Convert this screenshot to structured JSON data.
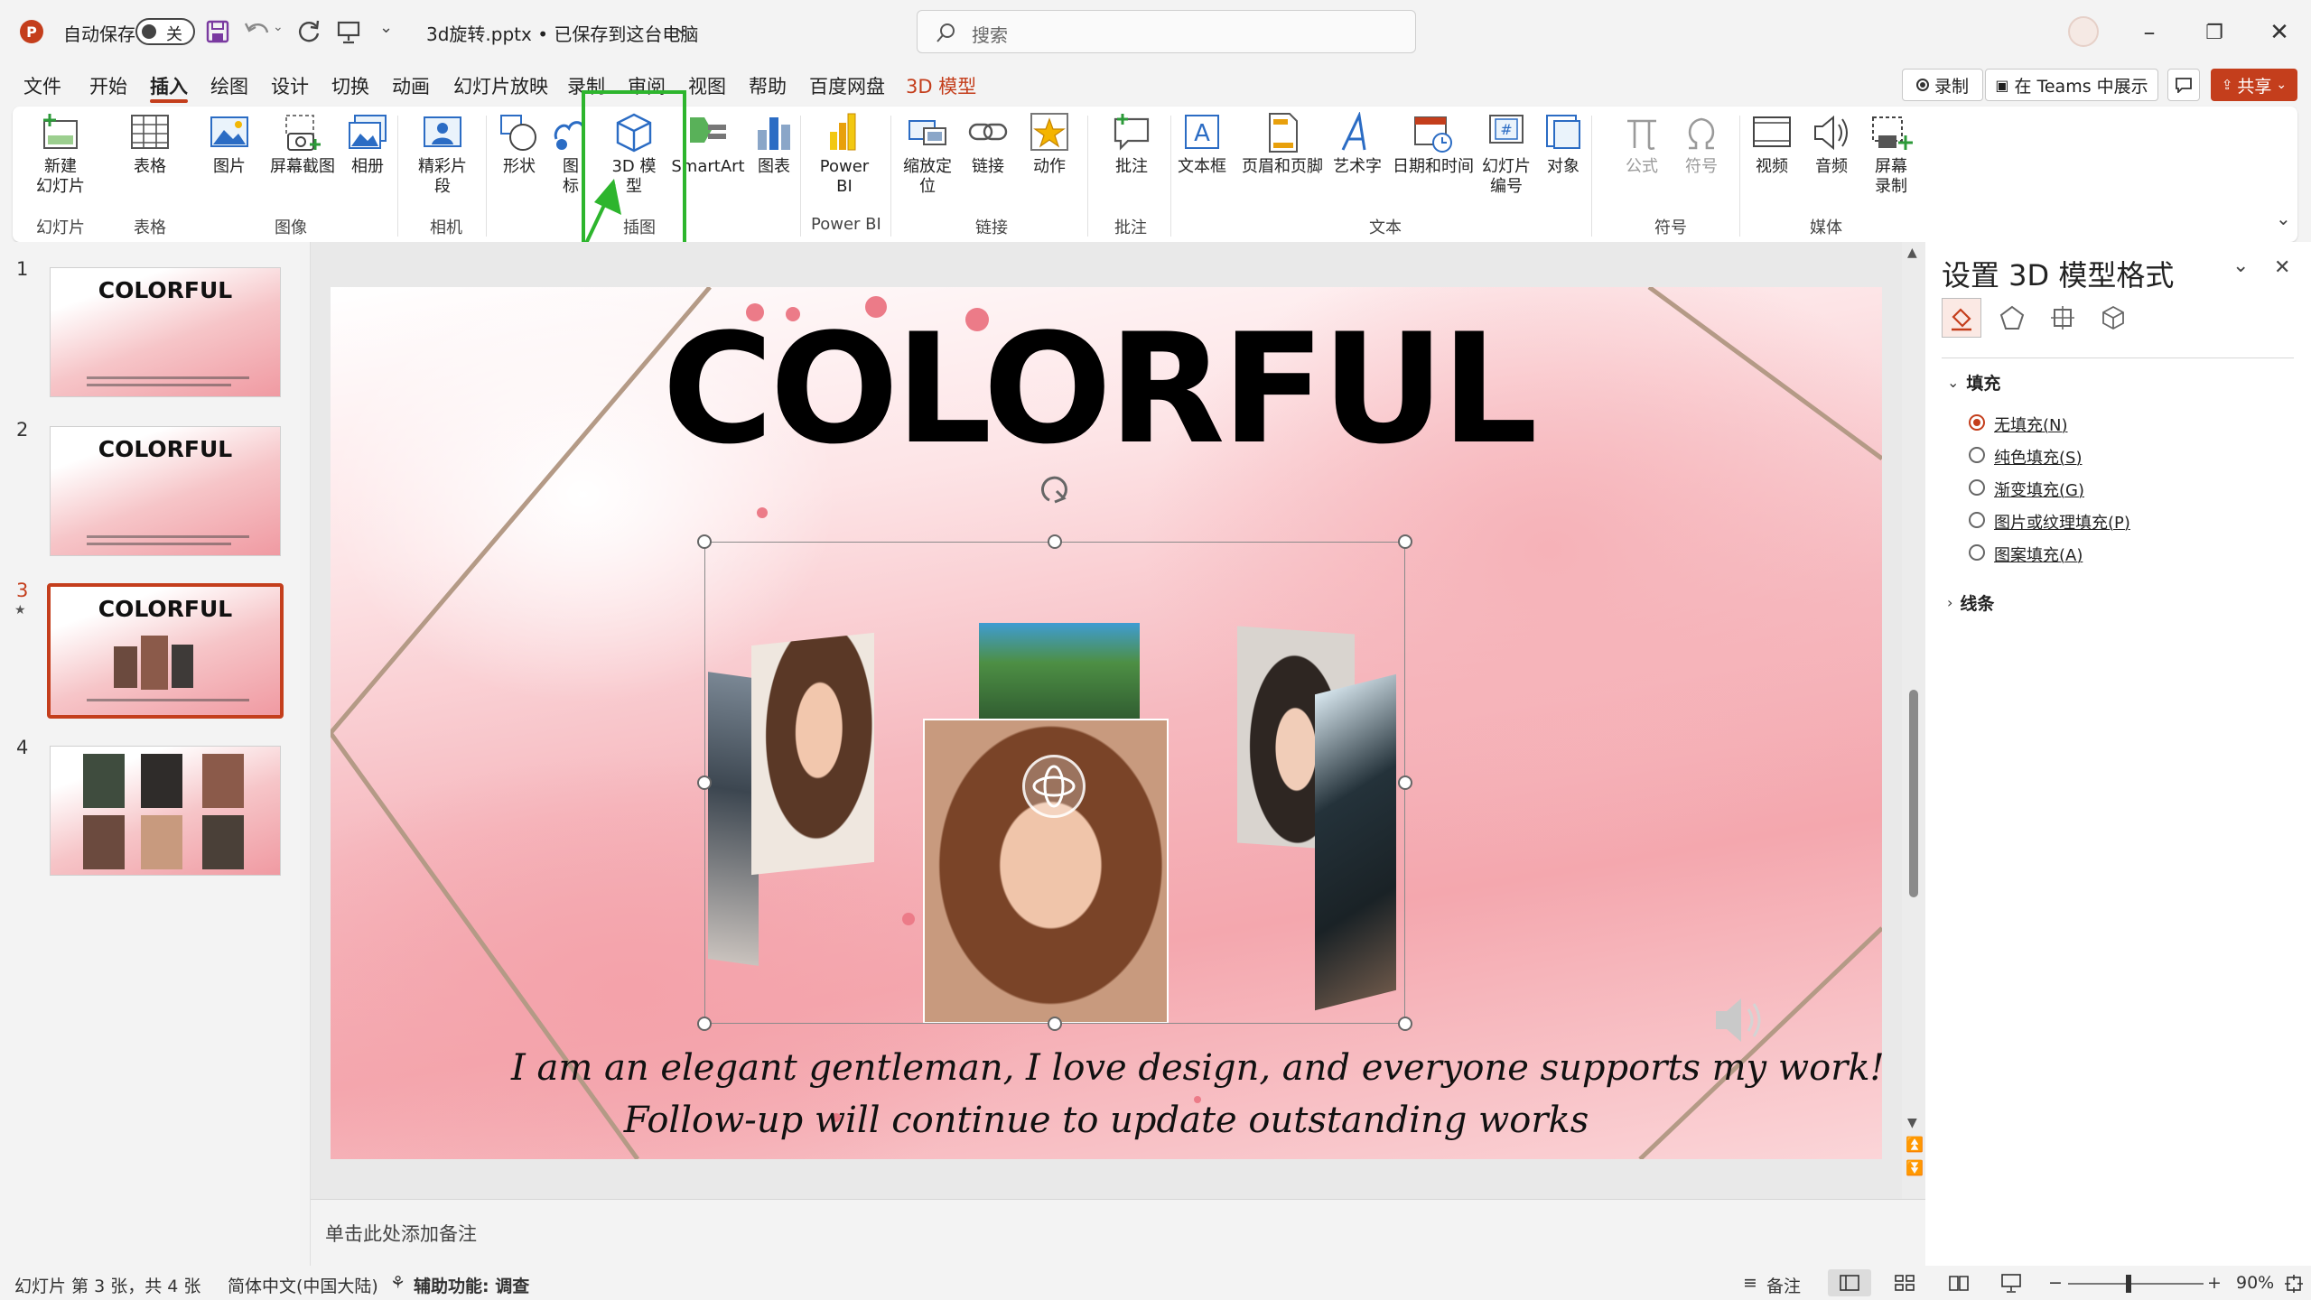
{
  "titlebar": {
    "autosave_label": "自动保存",
    "autosave_state": "关",
    "filename": "3d旋转.pptx • 已保存到这台电脑",
    "search_placeholder": "搜索"
  },
  "menu": {
    "tabs": [
      "文件",
      "开始",
      "插入",
      "绘图",
      "设计",
      "切换",
      "动画",
      "幻灯片放映",
      "录制",
      "审阅",
      "视图",
      "帮助",
      "百度网盘",
      "3D 模型"
    ],
    "active_tab": "插入",
    "record_button": "录制",
    "teams_button": "在 Teams 中展示",
    "share_button": "共享"
  },
  "ribbon": {
    "buttons": {
      "new_slide": "新建\n幻灯片",
      "table": "表格",
      "pictures": "图片",
      "screenshot": "屏幕截图",
      "album": "相册",
      "cameo": "精彩片\n段",
      "shapes": "形状",
      "icons": "图\n标",
      "model3d": "3D 模\n型",
      "smartart": "SmartArt",
      "chart": "图表",
      "powerbi": "Power\nBI",
      "zoom": "缩放定\n位",
      "link": "链接",
      "action": "动作",
      "comment": "批注",
      "textbox": "文本框",
      "header_footer": "页眉和页脚",
      "wordart": "艺术字",
      "datetime": "日期和时间",
      "slide_number": "幻灯片\n编号",
      "object": "对象",
      "equation": "公式",
      "symbol": "符号",
      "video": "视频",
      "audio": "音频",
      "screen_record": "屏幕\n录制"
    },
    "groups": {
      "slides": "幻灯片",
      "tables": "表格",
      "images": "图像",
      "camera": "相机",
      "illustrations": "插图",
      "powerbi": "Power BI",
      "links": "链接",
      "comments": "批注",
      "text": "文本",
      "symbols": "符号",
      "media": "媒体"
    }
  },
  "slides_panel": {
    "numbers": [
      "1",
      "2",
      "3",
      "4"
    ],
    "thumb_title": "COLORFUL",
    "selected": "3"
  },
  "slide": {
    "title": "COLORFUL",
    "line1": "I am an elegant gentleman, I love design, and everyone supports my work!",
    "line2": "Follow-up will continue to update outstanding works"
  },
  "notes_placeholder": "单击此处添加备注",
  "format_pane": {
    "title": "设置 3D 模型格式",
    "fill_section": "填充",
    "options": [
      "无填充(N)",
      "纯色填充(S)",
      "渐变填充(G)",
      "图片或纹理填充(P)",
      "图案填充(A)"
    ],
    "selected_option": "无填充(N)",
    "line_section": "线条"
  },
  "status": {
    "slide_info": "幻灯片 第 3 张，共 4 张",
    "language": "简体中文(中国大陆)",
    "accessibility": "辅助功能: 调查",
    "notes": "备注",
    "zoom": "90%"
  },
  "colors": {
    "accent": "#c43e1c",
    "highlight_box": "#2db52d",
    "ribbon_icon_blue": "#2b6cc4"
  }
}
